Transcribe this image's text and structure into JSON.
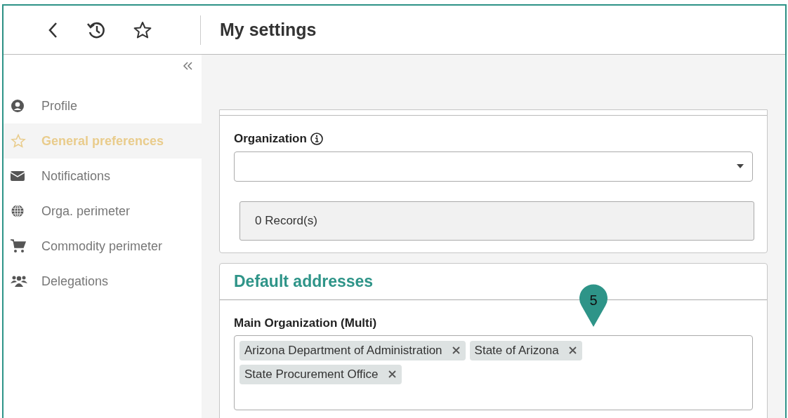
{
  "header": {
    "title": "My settings"
  },
  "sidebar": {
    "items": [
      {
        "kind": "profile",
        "label": "Profile",
        "selected": false
      },
      {
        "kind": "star",
        "label": "General preferences",
        "selected": true
      },
      {
        "kind": "mail",
        "label": "Notifications",
        "selected": false
      },
      {
        "kind": "globe",
        "label": "Orga. perimeter",
        "selected": false
      },
      {
        "kind": "cart",
        "label": "Commodity perimeter",
        "selected": false
      },
      {
        "kind": "people",
        "label": "Delegations",
        "selected": false
      }
    ]
  },
  "organization_card": {
    "label": "Organization",
    "records": "0 Record(s)"
  },
  "default_addresses": {
    "title": "Default addresses",
    "field_label": "Main Organization (Multi)",
    "tags": [
      "Arizona Department of Administration",
      "State of Arizona",
      "State Procurement Office"
    ]
  },
  "marker": {
    "number": "5"
  }
}
